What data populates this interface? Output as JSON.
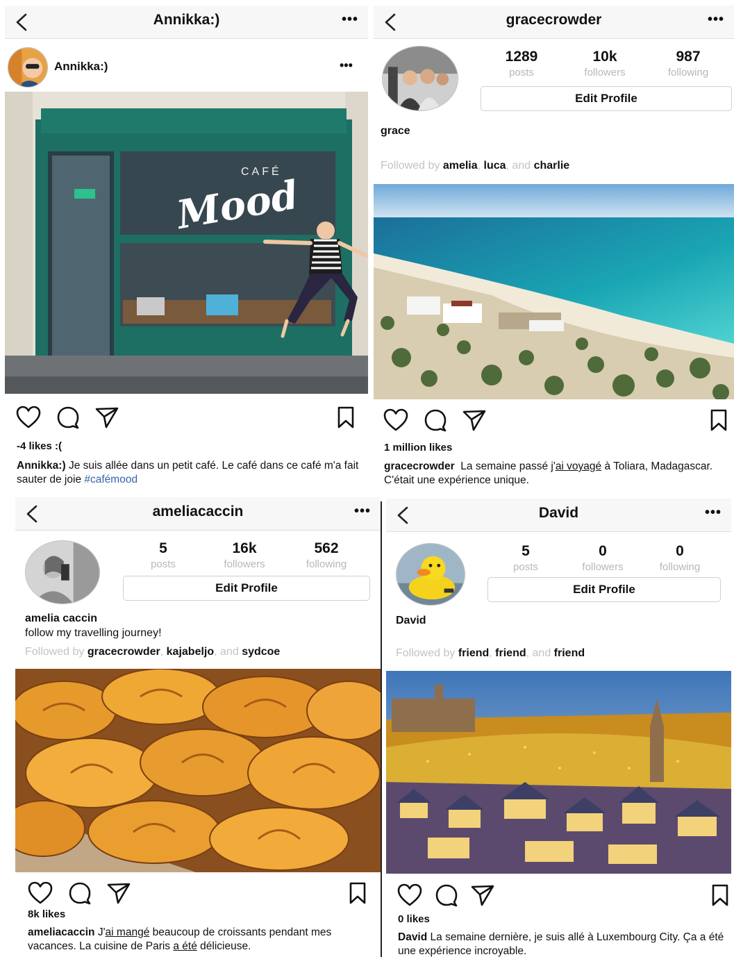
{
  "panel1": {
    "header_title": "Annikka:)",
    "more": "•••",
    "author": "Annikka:)",
    "author_more": "•••",
    "photo_sign_small": "CAFÉ",
    "photo_sign_big": "Mood",
    "likes": "-4 likes :(",
    "caption_user": "Annikka:)",
    "caption_text": "Je suis allée dans un petit café. Le café dans ce café m'a fait sauter de joie",
    "caption_tag": "#cafémood"
  },
  "panel2": {
    "header_title": "gracecrowder",
    "more": "•••",
    "stats": [
      {
        "num": "1289",
        "label": "posts"
      },
      {
        "num": "10k",
        "label": "followers"
      },
      {
        "num": "987",
        "label": "following"
      }
    ],
    "edit_profile": "Edit Profile",
    "bio_name": "grace",
    "followed_prefix": "Followed by",
    "followers": [
      "amelia",
      "luca",
      "charlie"
    ],
    "and_word": "and",
    "likes": "1 million likes",
    "caption_user": "gracecrowder",
    "caption_pre": "La semaine passé j'",
    "caption_underlined": "ai voyagé",
    "caption_post": "à Toliara, Madagascar. C'était une expérience unique."
  },
  "panel3": {
    "header_title": "ameliacaccin",
    "more": "•••",
    "stats": [
      {
        "num": "5",
        "label": "posts"
      },
      {
        "num": "16k",
        "label": "followers"
      },
      {
        "num": "562",
        "label": "following"
      }
    ],
    "edit_profile": "Edit Profile",
    "bio_name": "amelia caccin",
    "bio_text": "follow my travelling journey!",
    "followed_prefix": "Followed by",
    "followers": [
      "gracecrowder",
      "kajabeljo",
      "sydcoe"
    ],
    "and_word": "and",
    "likes": "8k likes",
    "caption_user": "ameliacaccin",
    "caption_pre": "J'",
    "caption_u1": "ai mangé",
    "caption_mid": "beaucoup de croissants pendant mes vacances.  La cuisine de Paris",
    "caption_u2": "a été",
    "caption_post": "délicieuse."
  },
  "panel4": {
    "header_title": "David",
    "more": "•••",
    "stats": [
      {
        "num": "5",
        "label": "posts"
      },
      {
        "num": "0",
        "label": "followers"
      },
      {
        "num": "0",
        "label": "following"
      }
    ],
    "edit_profile": "Edit Profile",
    "bio_name": "David",
    "followed_prefix": "Followed by",
    "followers": [
      "friend",
      "friend",
      "friend"
    ],
    "and_word": "and",
    "likes": "0 likes",
    "caption_user": "David",
    "caption_text": "La semaine dernière, je suis allé à Luxembourg City. Ça a été une expérience incroyable."
  },
  "icon_names": [
    "back-arrow-icon",
    "more-icon",
    "heart-icon",
    "comment-icon",
    "share-icon",
    "bookmark-icon"
  ],
  "colors": {
    "hashtag": "#3566a8",
    "muted": "#c3c3c3",
    "header_bg": "#f7f7f7"
  }
}
